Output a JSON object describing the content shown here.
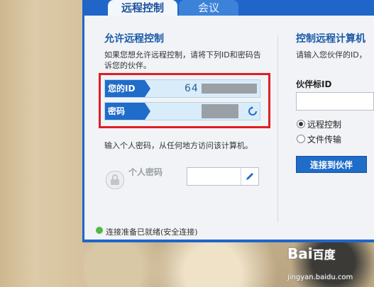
{
  "tabs": [
    {
      "label": "远程控制"
    },
    {
      "label": "会议"
    }
  ],
  "left": {
    "title": "允许远程控制",
    "description": "如果您想允许远程控制，请将下列ID和密码告诉您的伙伴。",
    "id_label": "您的ID",
    "id_value": "64",
    "password_label": "密码",
    "personal_desc": "输入个人密码，从任何地方访问该计算机。",
    "personal_label": "个人密码"
  },
  "right": {
    "title": "控制远程计算机",
    "description": "请输入您伙伴的ID，",
    "partner_label": "伙伴标ID",
    "option_remote": "远程控制",
    "option_file": "文件传输",
    "connect_label": "连接到伙伴"
  },
  "status": {
    "text": "连接准备已就绪(安全连接)",
    "color": "#53b747"
  },
  "watermark": {
    "logo": "Bai",
    "logo2": "百度",
    "sub": "jingyan.baidu.com"
  }
}
